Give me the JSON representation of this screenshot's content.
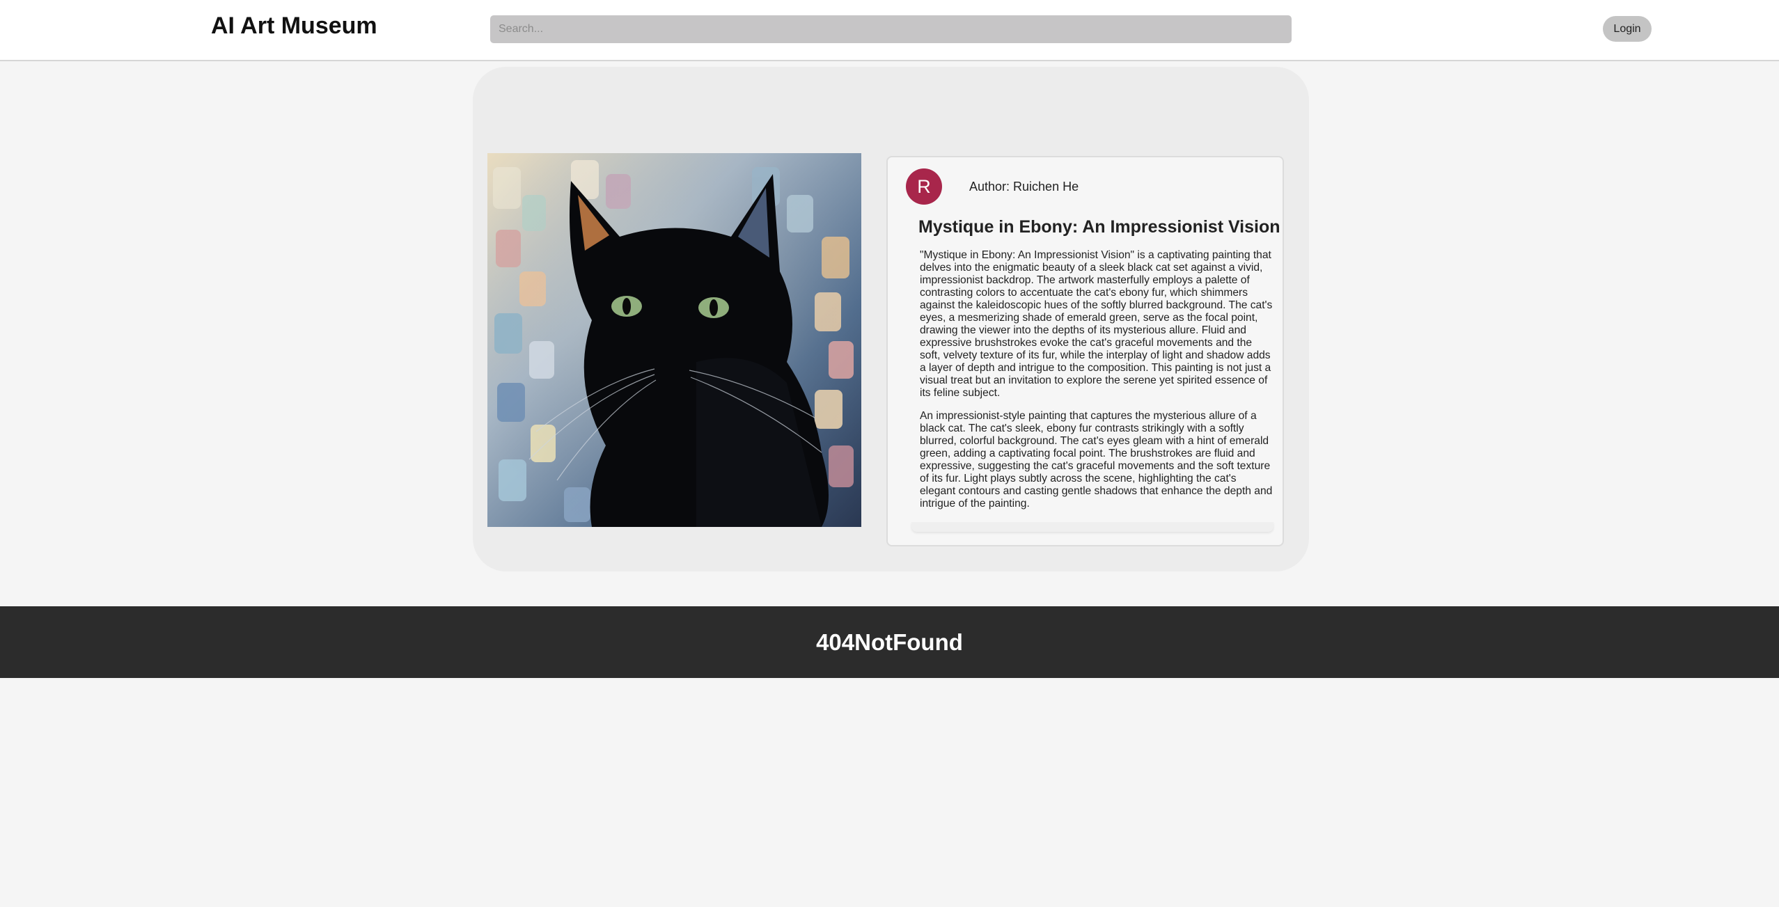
{
  "header": {
    "title": "AI Art Museum",
    "search": {
      "placeholder": "Search...",
      "value": ""
    },
    "login_label": "Login"
  },
  "artwork": {
    "image_icon": "black-cat-impressionist-painting",
    "author_initial": "R",
    "author_line": "Author: Ruichen He",
    "title": "Mystique in Ebony: An Impressionist Vision",
    "description": [
      "\"Mystique in Ebony: An Impressionist Vision\" is a captivating painting that delves into the enigmatic beauty of a sleek black cat set against a vivid, impressionist backdrop. The artwork masterfully employs a palette of contrasting colors to accentuate the cat's ebony fur, which shimmers against the kaleidoscopic hues of the softly blurred background. The cat's eyes, a mesmerizing shade of emerald green, serve as the focal point, drawing the viewer into the depths of its mysterious allure. Fluid and expressive brushstrokes evoke the cat's graceful movements and the soft, velvety texture of its fur, while the interplay of light and shadow adds a layer of depth and intrigue to the composition. This painting is not just a visual treat but an invitation to explore the serene yet spirited essence of its feline subject.",
      "An impressionist-style painting that captures the mysterious allure of a black cat. The cat's sleek, ebony fur contrasts strikingly with a softly blurred, colorful background. The cat's eyes gleam with a hint of emerald green, adding a captivating focal point. The brushstrokes are fluid and expressive, suggesting the cat's graceful movements and the soft texture of its fur. Light plays subtly across the scene, highlighting the cat's elegant contours and casting gentle shadows that enhance the depth and intrigue of the painting."
    ]
  },
  "footer": {
    "brand": "404NotFound"
  },
  "colors": {
    "avatar": "#a8264b",
    "footer_bg": "#2c2c2c",
    "panel_bg": "#ececec",
    "search_bg": "#c6c5c6"
  }
}
